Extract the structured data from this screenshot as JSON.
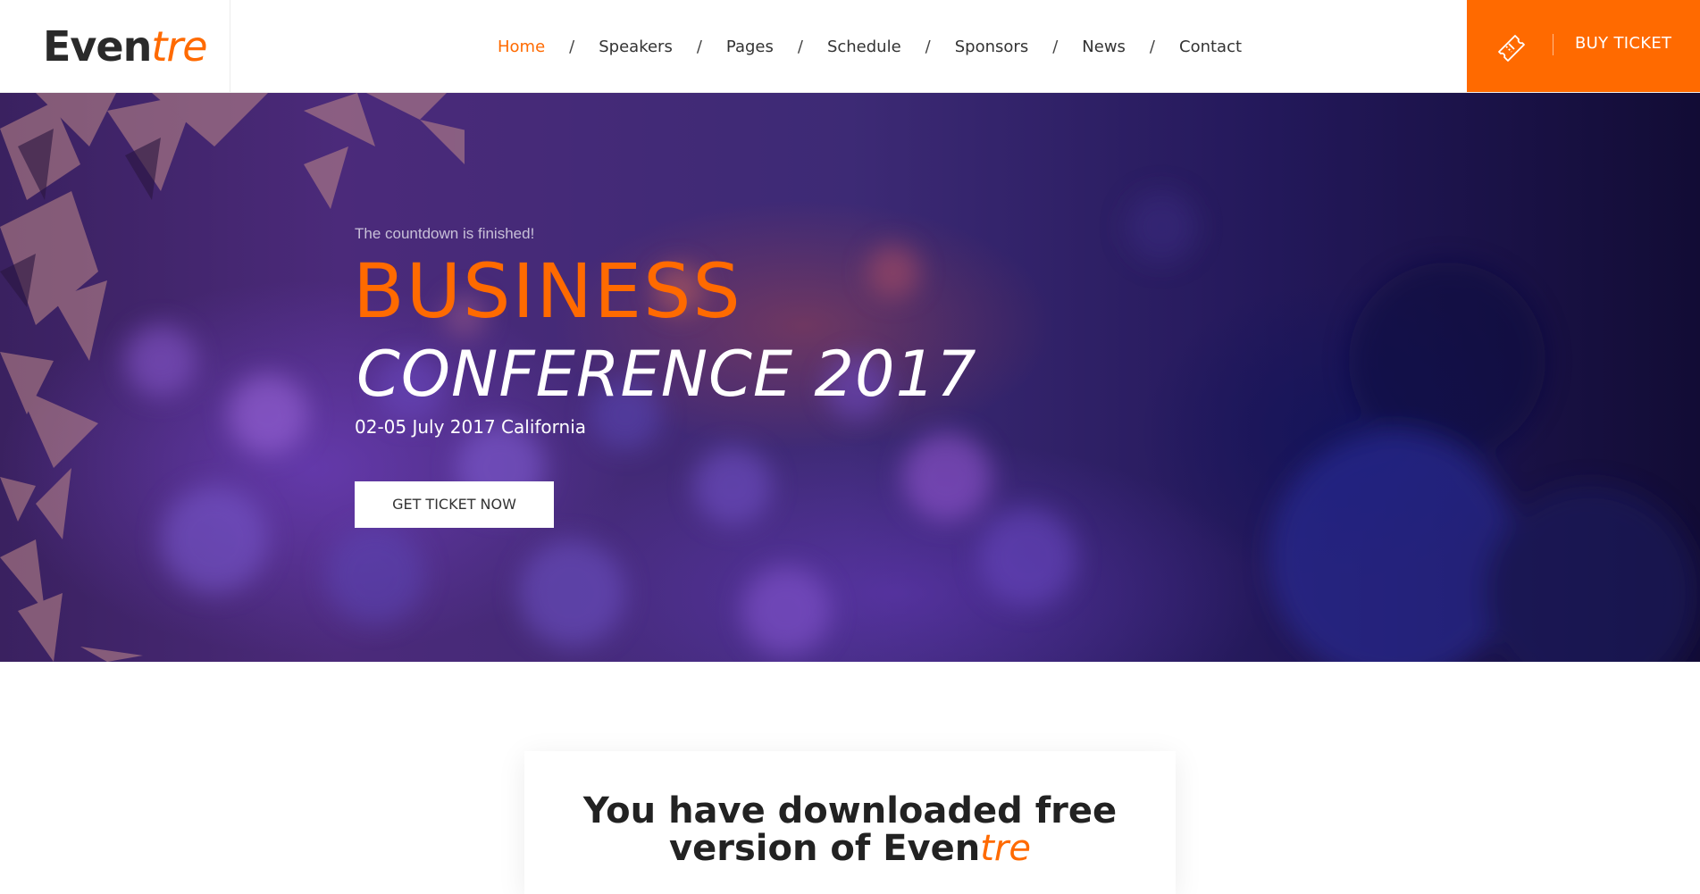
{
  "brand": {
    "logo_part1": "Even",
    "logo_part2": "tre"
  },
  "nav": {
    "items": [
      {
        "label": "Home",
        "active": true
      },
      {
        "label": "Speakers"
      },
      {
        "label": "Pages"
      },
      {
        "label": "Schedule"
      },
      {
        "label": "Sponsors"
      },
      {
        "label": "News"
      },
      {
        "label": "Contact"
      }
    ],
    "separator": "/"
  },
  "buy_ticket": {
    "label": "BUY TICKET",
    "icon": "ticket-icon"
  },
  "hero": {
    "countdown_text": "The countdown is finished!",
    "title_line1": "BUSINESS",
    "title_line2": "CONFERENCE 2017",
    "date_location": "02-05 July 2017 California",
    "cta_label": "GET TICKET NOW"
  },
  "download_card": {
    "title_line1": "You have downloaded free",
    "title_line2_prefix": "version of Even",
    "title_line2_brand": "tre"
  },
  "colors": {
    "accent": "#ff6a00",
    "text_dark": "#222222",
    "hero_bg": "#2c1b5a"
  }
}
